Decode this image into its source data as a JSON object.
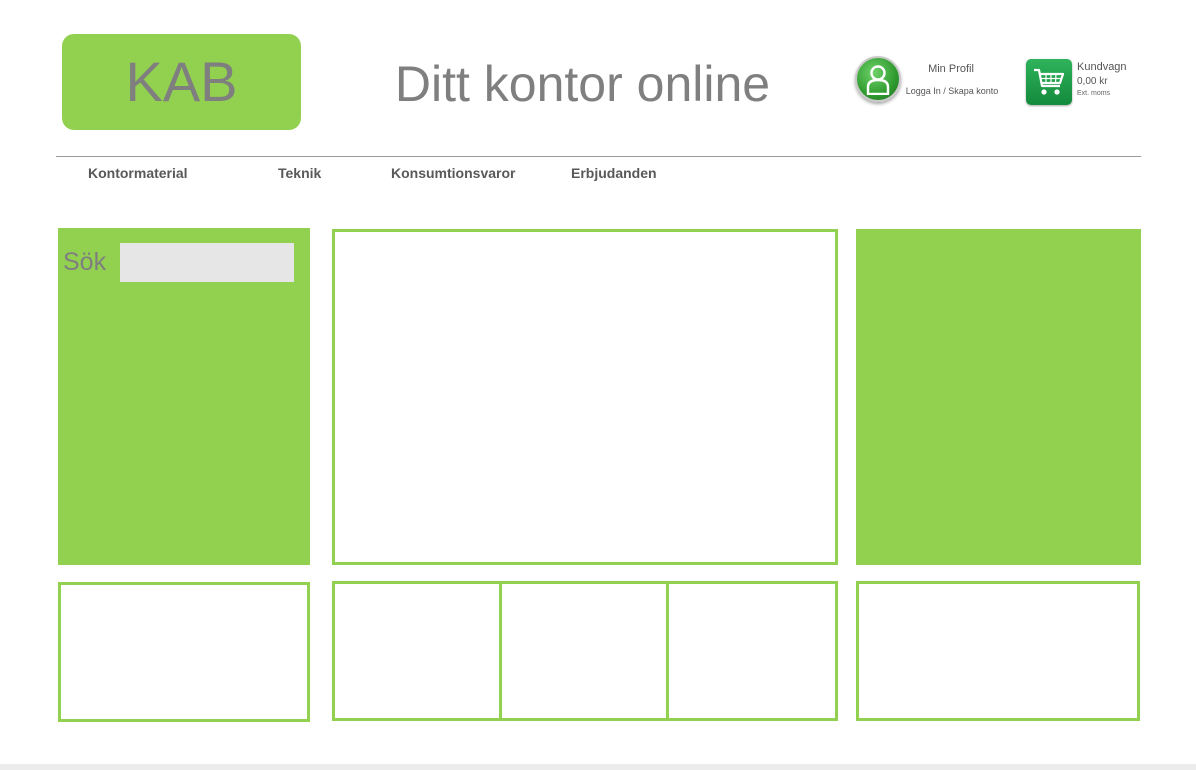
{
  "header": {
    "logo_text": "KAB",
    "title": "Ditt kontor online",
    "profile": {
      "icon": "user-profile-icon",
      "label": "Min Profil",
      "sublabel": "Logga In / Skapa konto"
    },
    "cart": {
      "icon": "shopping-cart-icon",
      "label": "Kundvagn",
      "amount": "0,00 kr",
      "vat_note": "Ext. moms"
    }
  },
  "nav": {
    "items": [
      {
        "label": "Kontormaterial"
      },
      {
        "label": "Teknik"
      },
      {
        "label": "Konsumtionsvaror"
      },
      {
        "label": "Erbjudanden"
      }
    ]
  },
  "search": {
    "label": "Sök",
    "value": "",
    "placeholder": ""
  },
  "colors": {
    "accent_green": "#92d050",
    "text_gray": "#7f7f7f",
    "cart_green": "#1e9e48"
  }
}
